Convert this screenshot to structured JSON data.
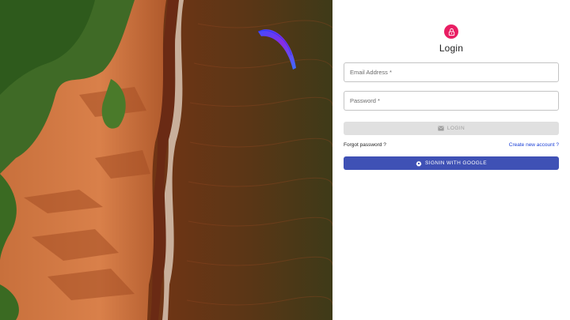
{
  "login": {
    "title": "Login",
    "email_label": "Email Address",
    "password_label": "Password",
    "required_mark": "*",
    "login_button": "LOGIN",
    "forgot_link": "Forgot password ?",
    "create_link": "Create new account ?",
    "google_button": "SIGNIN WITH GOOGLE"
  },
  "icons": {
    "avatar": "lock-icon",
    "login": "mail-icon",
    "google": "gear-icon"
  },
  "colors": {
    "avatar_bg": "#e91e63",
    "google_button_bg": "#3f51b5",
    "link": "#1a3fd6",
    "disabled_button_bg": "#e0e0e0"
  }
}
